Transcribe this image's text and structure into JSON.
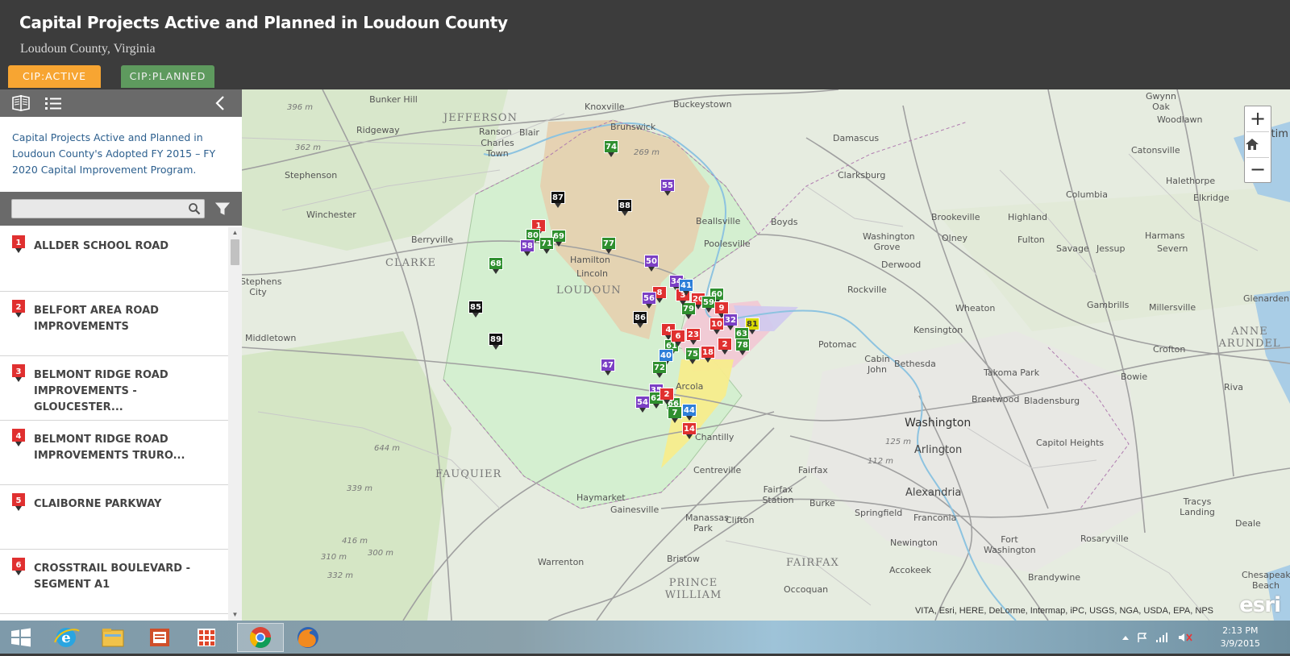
{
  "header": {
    "title": "Capital Projects Active and Planned in Loudoun County",
    "subtitle": "Loudoun County, Virginia",
    "tabs": [
      {
        "label": "CIP:ACTIVE",
        "color": "#f7a532"
      },
      {
        "label": "CIP:PLANNED",
        "color": "#5e9a5e"
      }
    ]
  },
  "sidebar": {
    "description": "Capital Projects Active and Planned in Loudoun County's Adopted FY 2015 – FY 2020 Capital Improvement Program.",
    "search": {
      "placeholder": "",
      "value": ""
    },
    "items": [
      {
        "num": "1",
        "label": "ALLDER SCHOOL ROAD"
      },
      {
        "num": "2",
        "label": "BELFORT AREA ROAD IMPROVEMENTS"
      },
      {
        "num": "3",
        "label": "BELMONT RIDGE ROAD IMPROVEMENTS - GLOUCESTER..."
      },
      {
        "num": "4",
        "label": "BELMONT RIDGE ROAD IMPROVEMENTS TRURO..."
      },
      {
        "num": "5",
        "label": "CLAIBORNE PARKWAY"
      },
      {
        "num": "6",
        "label": "CROSSTRAIL BOULEVARD - SEGMENT A1"
      }
    ]
  },
  "map": {
    "region_labels": {
      "jefferson": "JEFFERSON",
      "clarke": "CLARKE",
      "loudoun": "LOUDOUN",
      "fauquier": "FAUQUIER",
      "prince_william": "PRINCE WILLIAM",
      "fairfax": "FAIRFAX",
      "anne_arundel": "ANNE ARUNDEL"
    },
    "places": {
      "bunker_hill": "Bunker Hill",
      "knoxville": "Knoxville",
      "buckeystown": "Buckeystown",
      "gwynn_oak": "Gwynn Oak",
      "ridgeway": "Ridgeway",
      "ranson": "Ranson",
      "blair": "Blair",
      "charles_town": "Charles Town",
      "brunswick": "Brunswick",
      "damascus": "Damascus",
      "woodlawn": "Woodlawn",
      "catonsville": "Catonsville",
      "stephenson": "Stephenson",
      "clarksburg": "Clarksburg",
      "halethorpe": "Halethorpe",
      "winchester": "Winchester",
      "beallsville": "Beallsville",
      "boyds": "Boyds",
      "berryville": "Berryville",
      "poolesville": "Poolesville",
      "washington_grove": "Washington Grove",
      "olney": "Olney",
      "brookeville": "Brookeville",
      "highland": "Highland",
      "fulton": "Fulton",
      "columbia": "Columbia",
      "elkridge": "Elkridge",
      "stephens_city": "Stephens City",
      "hamilton": "Hamilton",
      "lincoln": "Lincoln",
      "derwood": "Derwood",
      "savage": "Savage",
      "jessup": "Jessup",
      "severn": "Severn",
      "middletown": "Middletown",
      "rockville": "Rockville",
      "potomac": "Potomac",
      "bethesda": "Bethesda",
      "wheaton": "Wheaton",
      "kensington": "Kensington",
      "cabin_john": "Cabin John",
      "crofton": "Crofton",
      "takoma_park": "Takoma Park",
      "bowie": "Bowie",
      "arcola": "Arcola",
      "brentwood": "Brentwood",
      "bladensburg": "Bladensburg",
      "washington": "Washington",
      "chantilly": "Chantilly",
      "arlington": "Arlington",
      "capitol_heights": "Capitol Heights",
      "centreville": "Centreville",
      "fairfax_city": "Fairfax",
      "alexandria": "Alexandria",
      "haymarket": "Haymarket",
      "gainesville": "Gainesville",
      "fairfax_station": "Fairfax Station",
      "burke": "Burke",
      "springfield": "Springfield",
      "franconia": "Franconia",
      "manassas_park": "Manassas Park",
      "clifton": "Clifton",
      "newington": "Newington",
      "fort_washington": "Fort Washington",
      "rosaryville": "Rosaryville",
      "warrenton": "Warrenton",
      "bristow": "Bristow",
      "occoquan": "Occoquan",
      "accokeek": "Accokeek",
      "brandywine": "Brandywine",
      "riva": "Riva",
      "deale": "Deale",
      "tracys_landing": "Tracys Landing",
      "chesapeake_beach": "Chesapeake Beach",
      "baltimore": "Baltim",
      "harmans": "Harmans",
      "millersville": "Millersville",
      "gambrills": "Gambrills",
      "glenarden": "Glenarden"
    },
    "elevations": [
      "396 m",
      "362 m",
      "269 m",
      "644 m",
      "339 m",
      "416 m",
      "300 m",
      "332 m",
      "310 m",
      "125 m",
      "112 m"
    ],
    "zoom_in": "+",
    "zoom_out": "−",
    "attribution": "VITA, Esri, HERE, DeLorme, Intermap, iPC, USGS, NGA, USDA, EPA, NPS",
    "logo": "esri",
    "markers": [
      {
        "n": "74",
        "c": "#2f8f2f"
      },
      {
        "n": "55",
        "c": "#7b3fc4"
      },
      {
        "n": "87",
        "c": "#111"
      },
      {
        "n": "88",
        "c": "#111"
      },
      {
        "n": "1",
        "c": "#e03030"
      },
      {
        "n": "80",
        "c": "#2f8f2f"
      },
      {
        "n": "69",
        "c": "#2f8f2f"
      },
      {
        "n": "58",
        "c": "#7b3fc4"
      },
      {
        "n": "71",
        "c": "#2f8f2f"
      },
      {
        "n": "77",
        "c": "#2f8f2f"
      },
      {
        "n": "68",
        "c": "#2f8f2f"
      },
      {
        "n": "50",
        "c": "#7b3fc4"
      },
      {
        "n": "34",
        "c": "#7b3fc4"
      },
      {
        "n": "8",
        "c": "#e03030"
      },
      {
        "n": "56",
        "c": "#7b3fc4"
      },
      {
        "n": "60",
        "c": "#2f8f2f"
      },
      {
        "n": "20",
        "c": "#e03030"
      },
      {
        "n": "59",
        "c": "#2f8f2f"
      },
      {
        "n": "79",
        "c": "#2f8f2f"
      },
      {
        "n": "3",
        "c": "#e03030"
      },
      {
        "n": "9",
        "c": "#e03030"
      },
      {
        "n": "85",
        "c": "#111"
      },
      {
        "n": "86",
        "c": "#111"
      },
      {
        "n": "10",
        "c": "#e03030"
      },
      {
        "n": "32",
        "c": "#7b3fc4"
      },
      {
        "n": "81",
        "c": "#d9d900"
      },
      {
        "n": "89",
        "c": "#111"
      },
      {
        "n": "4",
        "c": "#e03030"
      },
      {
        "n": "23",
        "c": "#e03030"
      },
      {
        "n": "63",
        "c": "#2f8f2f"
      },
      {
        "n": "61",
        "c": "#2f8f2f"
      },
      {
        "n": "18",
        "c": "#e03030"
      },
      {
        "n": "78",
        "c": "#2f8f2f"
      },
      {
        "n": "75",
        "c": "#2f8f2f"
      },
      {
        "n": "40",
        "c": "#2e7fd9"
      },
      {
        "n": "72",
        "c": "#2f8f2f"
      },
      {
        "n": "47",
        "c": "#7b3fc4"
      },
      {
        "n": "35",
        "c": "#7b3fc4"
      },
      {
        "n": "62",
        "c": "#2f8f2f"
      },
      {
        "n": "54",
        "c": "#7b3fc4"
      },
      {
        "n": "66",
        "c": "#2f8f2f"
      },
      {
        "n": "44",
        "c": "#2e7fd9"
      },
      {
        "n": "14",
        "c": "#e03030"
      },
      {
        "n": "41",
        "c": "#2e7fd9"
      },
      {
        "n": "2",
        "c": "#e03030"
      },
      {
        "n": "7",
        "c": "#2f8f2f"
      },
      {
        "n": "6",
        "c": "#e03030"
      },
      {
        "n": "2",
        "c": "#e03030"
      }
    ]
  },
  "taskbar": {
    "apps": [
      "start-icon",
      "internet-explorer-icon",
      "file-explorer-icon",
      "office-icon",
      "apps-grid-icon",
      "chrome-icon",
      "firefox-icon"
    ],
    "time": "2:13 PM",
    "date": "3/9/2015"
  },
  "colors": {
    "header_bg": "#3c3c3c",
    "toolbar_bg": "#6a6a6a",
    "active_tab": "#f7a532",
    "planned_tab": "#5e9a5e",
    "link_text": "#2c5f8e",
    "pin_red": "#e03030"
  }
}
